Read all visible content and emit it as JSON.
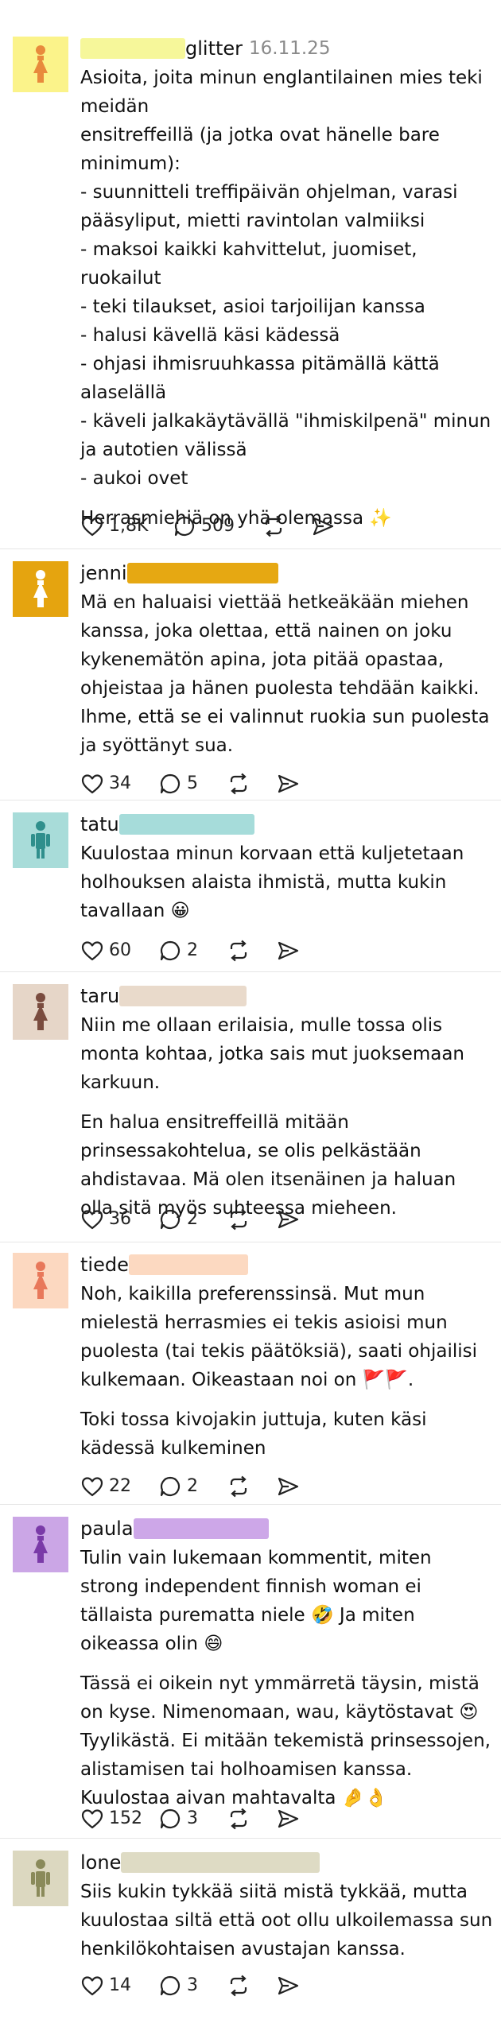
{
  "posts": [
    {
      "username": "glitter",
      "date": "16.11.25",
      "avatar_bg": "#fbf38a",
      "avatar_fg": "#e88a3c",
      "blur_color": "#f6f79a",
      "paragraphs": [
        "Asioita, joita minun englantilainen mies teki meidän\nensitreffeillä (ja jotka ovat hänelle bare minimum):\n- suunnitteli treffipäivän ohjelman, varasi pääsyliput, mietti ravintolan valmiiksi\n- maksoi kaikki kahvittelut, juomiset, ruokailut\n- teki tilaukset, asioi tarjoilijan kanssa\n- halusi kävellä käsi kädessä\n- ohjasi ihmisruuhkassa pitämällä kättä alaselällä\n- käveli jalkakäytävällä \"ihmiskilpenä\" minun ja autotien välissä\n- aukoi ovet",
        "Herrasmiehiä on yhä olemassa ✨"
      ],
      "likes": "1,8K",
      "replies": "509"
    },
    {
      "username": "jenni",
      "avatar_bg": "#e5a40f",
      "avatar_fg": "#ffffff",
      "blur_color": "#e6a812",
      "paragraphs": [
        "Mä en haluaisi viettää hetkeäkään miehen kanssa, joka olettaa, että nainen on joku kykenemätön apina, jota pitää opastaa, ohjeistaa ja hänen puolesta tehdään kaikki. Ihme, että se ei valinnut ruokia sun puolesta ja syöttänyt sua."
      ],
      "likes": "34",
      "replies": "5"
    },
    {
      "username": "tatu",
      "avatar_bg": "#a8dcd9",
      "avatar_fg": "#2f8f8c",
      "blur_color": "#a6dcda",
      "paragraphs": [
        "Kuulostaa minun korvaan että kuljetetaan holhouksen alaista ihmistä, mutta kukin tavallaan 😀"
      ],
      "likes": "60",
      "replies": "2"
    },
    {
      "username": "taru",
      "avatar_bg": "#e6d6c8",
      "avatar_fg": "#7a4c3f",
      "blur_color": "#e9dacb",
      "paragraphs": [
        "Niin me ollaan erilaisia, mulle tossa olis monta kohtaa, jotka sais mut juoksemaan karkuun.",
        "En halua ensitreffeillä mitään prinsessakohtelua, se olis pelkästään ahdistavaa. Mä olen itsenäinen ja haluan olla sitä myös suhteessa mieheen."
      ],
      "likes": "36",
      "replies": "2"
    },
    {
      "username": "tiede",
      "avatar_bg": "#fcd8c0",
      "avatar_fg": "#e8785a",
      "blur_color": "#fcd9c1",
      "paragraphs": [
        "Noh, kaikilla preferenssinsä. Mut mun mielestä herrasmies ei tekis asioisi mun puolesta (tai tekis päätöksiä), saati ohjailisi kulkemaan. Oikeastaan noi on 🚩🚩.",
        "Toki tossa kivojakin juttuja, kuten käsi kädessä kulkeminen"
      ],
      "likes": "22",
      "replies": "2"
    },
    {
      "username": "paula",
      "avatar_bg": "#cba6e6",
      "avatar_fg": "#7a3aa8",
      "blur_color": "#cda7e8",
      "paragraphs": [
        "Tulin vain lukemaan kommentit, miten strong independent finnish woman ei tällaista purematta niele 🤣 Ja miten oikeassa olin 😄",
        "Tässä ei oikein nyt ymmärretä täysin, mistä on kyse. Nimenomaan, wau, käytöstavat 😍 Tyylikästä. Ei mitään tekemistä prinsessojen, alistamisen tai holhoamisen kanssa. Kuulostaa aivan mahtavalta 🤌👌"
      ],
      "likes": "152",
      "replies": "3"
    },
    {
      "username": "lone",
      "avatar_bg": "#dcd8c0",
      "avatar_fg": "#8a8a5a",
      "blur_color": "#dedbc4",
      "paragraphs": [
        "Siis kukin tykkää siitä mistä tykkää, mutta kuulostaa siltä että oot ollu ulkoilemassa sun henkilökohtaisen avustajan kanssa."
      ],
      "likes": "14",
      "replies": "3"
    }
  ],
  "icons": {
    "like": "heart-icon",
    "reply": "speech-bubble-icon",
    "repost": "repost-icon",
    "share": "share-icon"
  }
}
